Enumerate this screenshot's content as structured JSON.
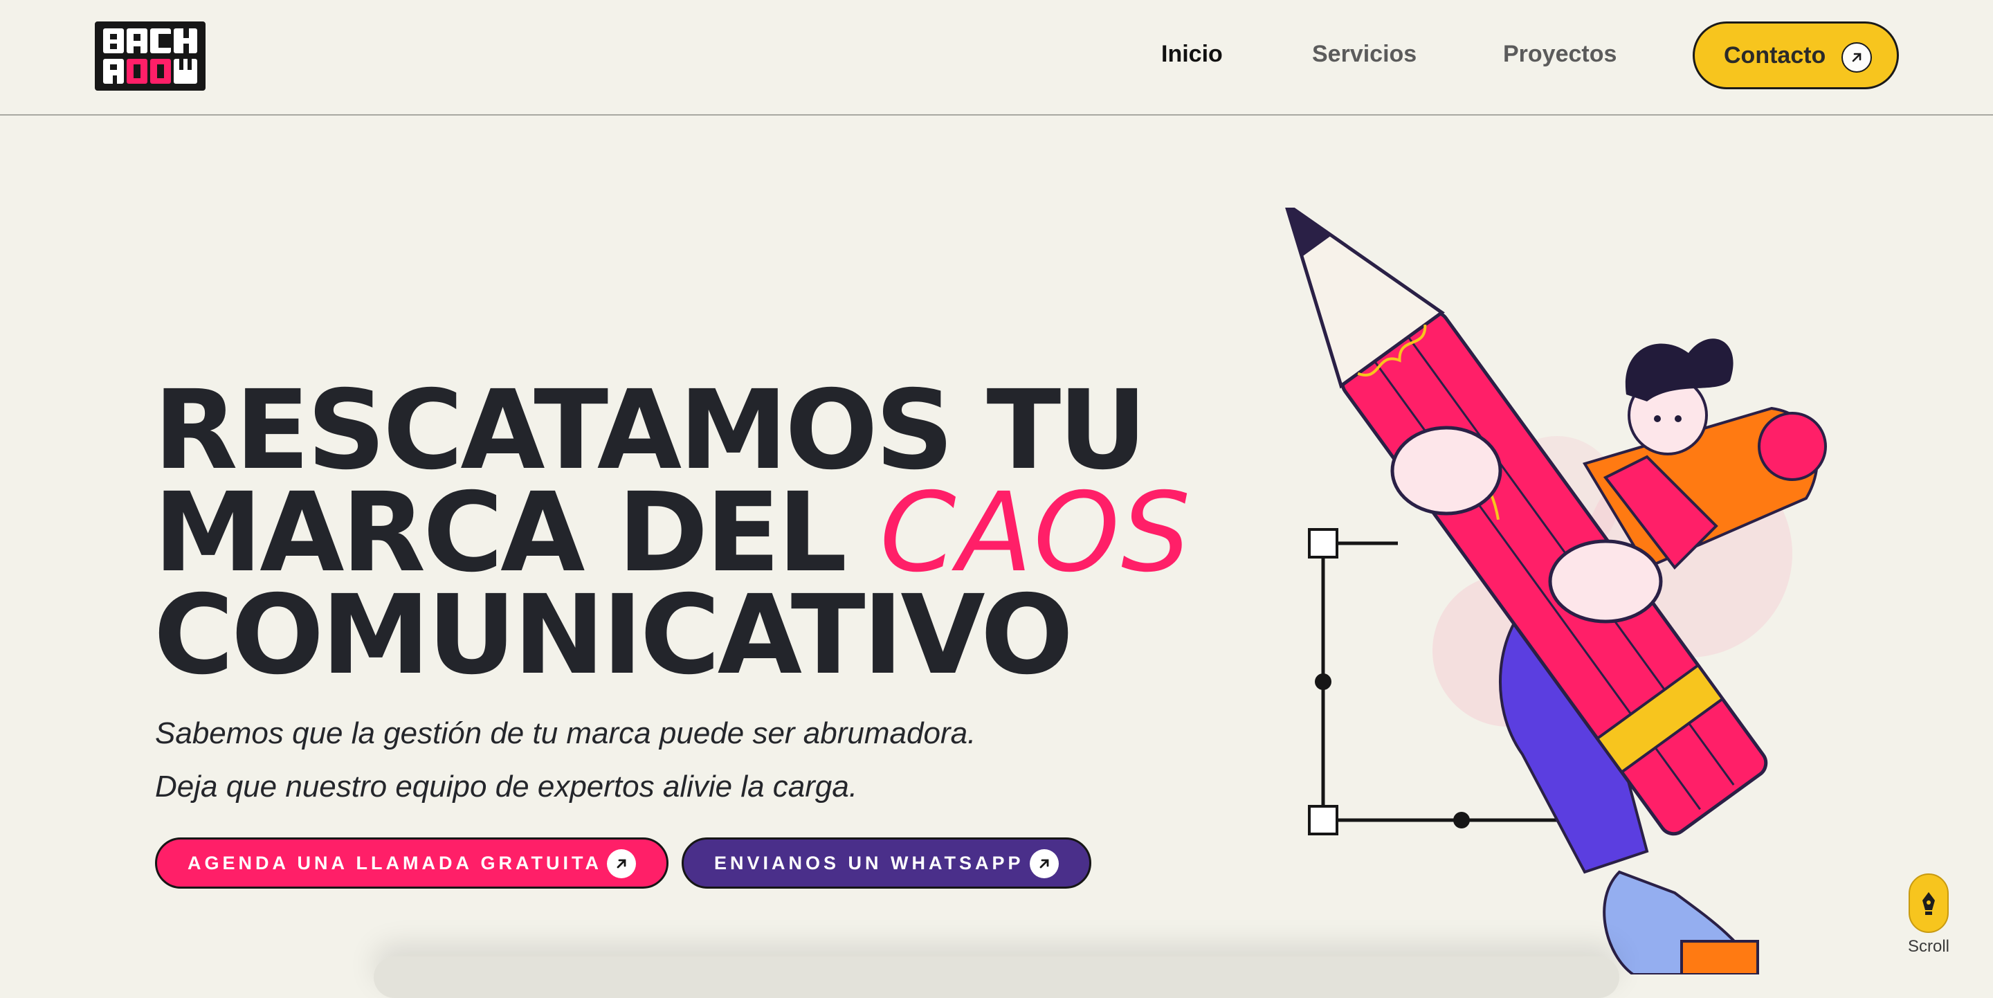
{
  "brand": {
    "logo_text": "BACK ROOM",
    "accent_pink": "#ff1f68",
    "accent_yellow": "#f7c51e",
    "accent_purple": "#4a2f8a",
    "background": "#f3f2ea"
  },
  "nav": {
    "items": [
      {
        "label": "Inicio",
        "active": true
      },
      {
        "label": "Servicios",
        "active": false
      },
      {
        "label": "Proyectos",
        "active": false
      }
    ],
    "contact_label": "Contacto",
    "contact_icon": "arrow-up-right-icon"
  },
  "hero": {
    "title_line1": "RESCATAMOS TU",
    "title_line2_prefix": "MARCA DEL ",
    "title_line2_accent": "CAOS",
    "title_line3": "COMUNICATIVO",
    "subtitle_line1": "Sabemos que la gestión de tu marca puede ser abrumadora.",
    "subtitle_line2": "Deja que nuestro equipo de expertos alivie la carga.",
    "cta_primary": "AGENDA UNA LLAMADA GRATUITA",
    "cta_secondary": "ENVIANOS UN WHATSAPP",
    "cta_icon": "arrow-up-right-icon"
  },
  "scroll": {
    "label": "Scroll",
    "icon": "pen-nib-icon"
  }
}
